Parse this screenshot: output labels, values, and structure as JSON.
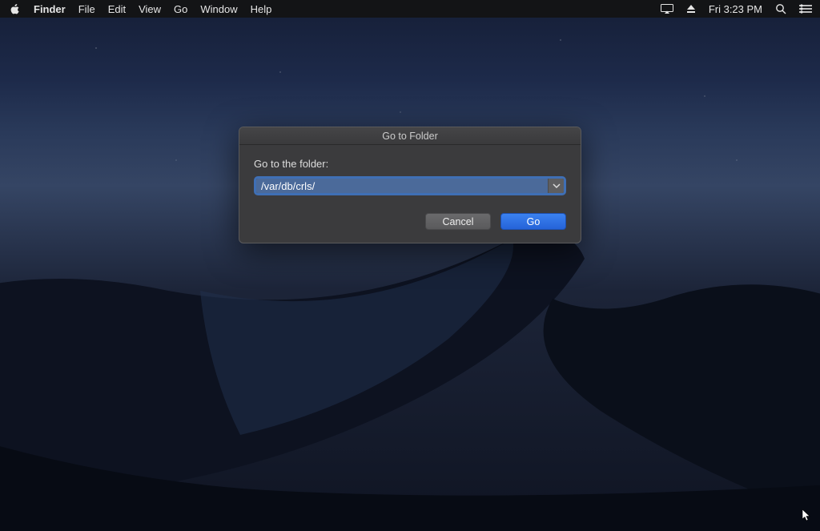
{
  "menubar": {
    "app_name": "Finder",
    "items": [
      "File",
      "Edit",
      "View",
      "Go",
      "Window",
      "Help"
    ],
    "clock": "Fri 3:23 PM"
  },
  "dialog": {
    "title": "Go to Folder",
    "prompt": "Go to the folder:",
    "path_value": "/var/db/crls/",
    "cancel_label": "Cancel",
    "go_label": "Go"
  }
}
